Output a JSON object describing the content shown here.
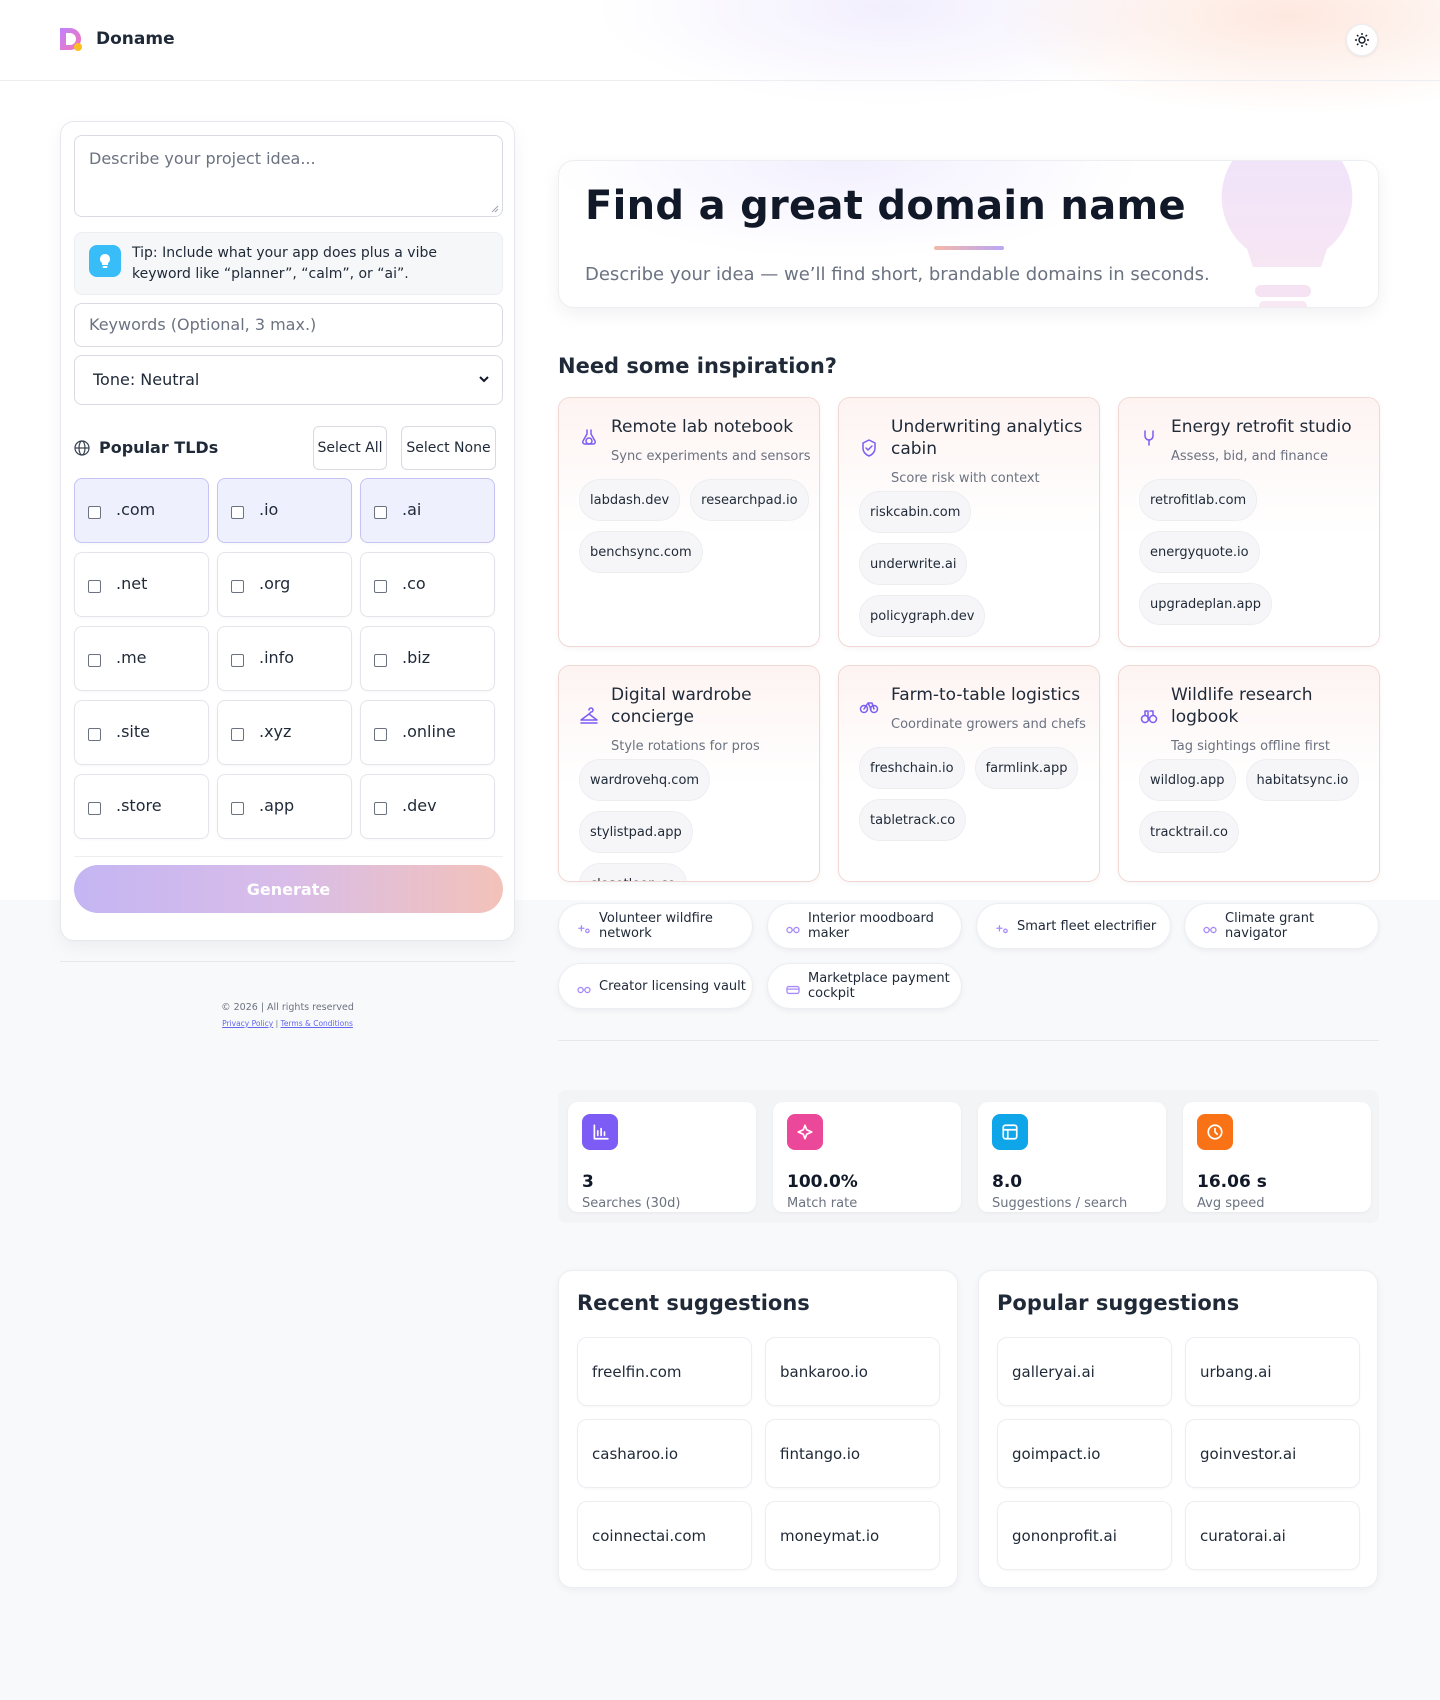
{
  "brand": {
    "name": "Doname"
  },
  "form": {
    "idea_placeholder": "Describe your project idea...",
    "tip": "Tip: Include what your app does plus a vibe keyword like “planner”, “calm”, or “ai”.",
    "keywords_placeholder": "Keywords (Optional, 3 max.)",
    "tone_value": "Tone: Neutral",
    "tld_title": "Popular TLDs",
    "select_all": "Select All",
    "select_none": "Select None",
    "tlds": [
      {
        "label": ".com",
        "selected": true
      },
      {
        "label": ".io",
        "selected": true
      },
      {
        "label": ".ai",
        "selected": true
      },
      {
        "label": ".net",
        "selected": false
      },
      {
        "label": ".org",
        "selected": false
      },
      {
        "label": ".co",
        "selected": false
      },
      {
        "label": ".me",
        "selected": false
      },
      {
        "label": ".info",
        "selected": false
      },
      {
        "label": ".biz",
        "selected": false
      },
      {
        "label": ".site",
        "selected": false
      },
      {
        "label": ".xyz",
        "selected": false
      },
      {
        "label": ".online",
        "selected": false
      },
      {
        "label": ".store",
        "selected": false
      },
      {
        "label": ".app",
        "selected": false
      },
      {
        "label": ".dev",
        "selected": false
      }
    ],
    "generate_label": "Generate"
  },
  "footer": {
    "copyright": "© 2026 | All rights reserved",
    "privacy": "Privacy Policy",
    "separator": "|",
    "terms": "Terms & Conditions"
  },
  "hero": {
    "title": "Find a great domain name",
    "subtitle": "Describe your idea — we’ll find short, brandable domains in seconds."
  },
  "inspiration": {
    "title": "Need some inspiration?",
    "cards": [
      {
        "title": "Remote lab notebook",
        "subtitle": "Sync experiments and sensors",
        "icon": "flask-icon",
        "domains": [
          "labdash.dev",
          "researchpad.io",
          "benchsync.com"
        ]
      },
      {
        "title": "Underwriting analytics cabin",
        "subtitle": "Score risk with context",
        "icon": "shield-icon",
        "domains": [
          "riskcabin.com",
          "underwrite.ai",
          "policygraph.dev"
        ]
      },
      {
        "title": "Energy retrofit studio",
        "subtitle": "Assess, bid, and finance",
        "icon": "plug-icon",
        "domains": [
          "retrofitlab.com",
          "energyquote.io",
          "upgradeplan.app"
        ]
      },
      {
        "title": "Digital wardrobe concierge",
        "subtitle": "Style rotations for pros",
        "icon": "hanger-icon",
        "domains": [
          "wardrovehq.com",
          "stylistpad.app",
          "closetloop.co"
        ]
      },
      {
        "title": "Farm-to-table logistics",
        "subtitle": "Coordinate growers and chefs",
        "icon": "bike-icon",
        "domains": [
          "freshchain.io",
          "farmlink.app",
          "tabletrack.co"
        ]
      },
      {
        "title": "Wildlife research logbook",
        "subtitle": "Tag sightings offline first",
        "icon": "binoculars-icon",
        "domains": [
          "wildlog.app",
          "habitatsync.io",
          "tracktrail.co"
        ]
      }
    ],
    "pills": [
      {
        "label": "Volunteer wildfire network",
        "icon": "sparkle-icon"
      },
      {
        "label": "Interior moodboard maker",
        "icon": "glasses-icon"
      },
      {
        "label": "Smart fleet electrifier",
        "icon": "sparkle-icon"
      },
      {
        "label": "Climate grant navigator",
        "icon": "glasses-icon"
      },
      {
        "label": "Creator licensing vault",
        "icon": "glasses-icon"
      },
      {
        "label": "Marketplace payment cockpit",
        "icon": "card-icon"
      }
    ]
  },
  "stats": [
    {
      "value": "3",
      "label": "Searches (30d)",
      "color": "#7c5cf4",
      "icon": "chart-icon"
    },
    {
      "value": "100.0%",
      "label": "Match rate",
      "color": "#ec4899",
      "icon": "sparkles-icon"
    },
    {
      "value": "8.0",
      "label": "Suggestions / search",
      "color": "#0ea5e9",
      "icon": "layout-icon"
    },
    {
      "value": "16.06 s",
      "label": "Avg speed",
      "color": "#f97316",
      "icon": "clock-icon"
    }
  ],
  "recent": {
    "title": "Recent suggestions",
    "items": [
      "freelfin.com",
      "bankaroo.io",
      "casharoo.io",
      "fintango.io",
      "coinnectai.com",
      "moneymat.io"
    ]
  },
  "popular": {
    "title": "Popular suggestions",
    "items": [
      "galleryai.ai",
      "urbang.ai",
      "goimpact.io",
      "goinvestor.ai",
      "gononprofit.ai",
      "curatorai.ai"
    ]
  }
}
